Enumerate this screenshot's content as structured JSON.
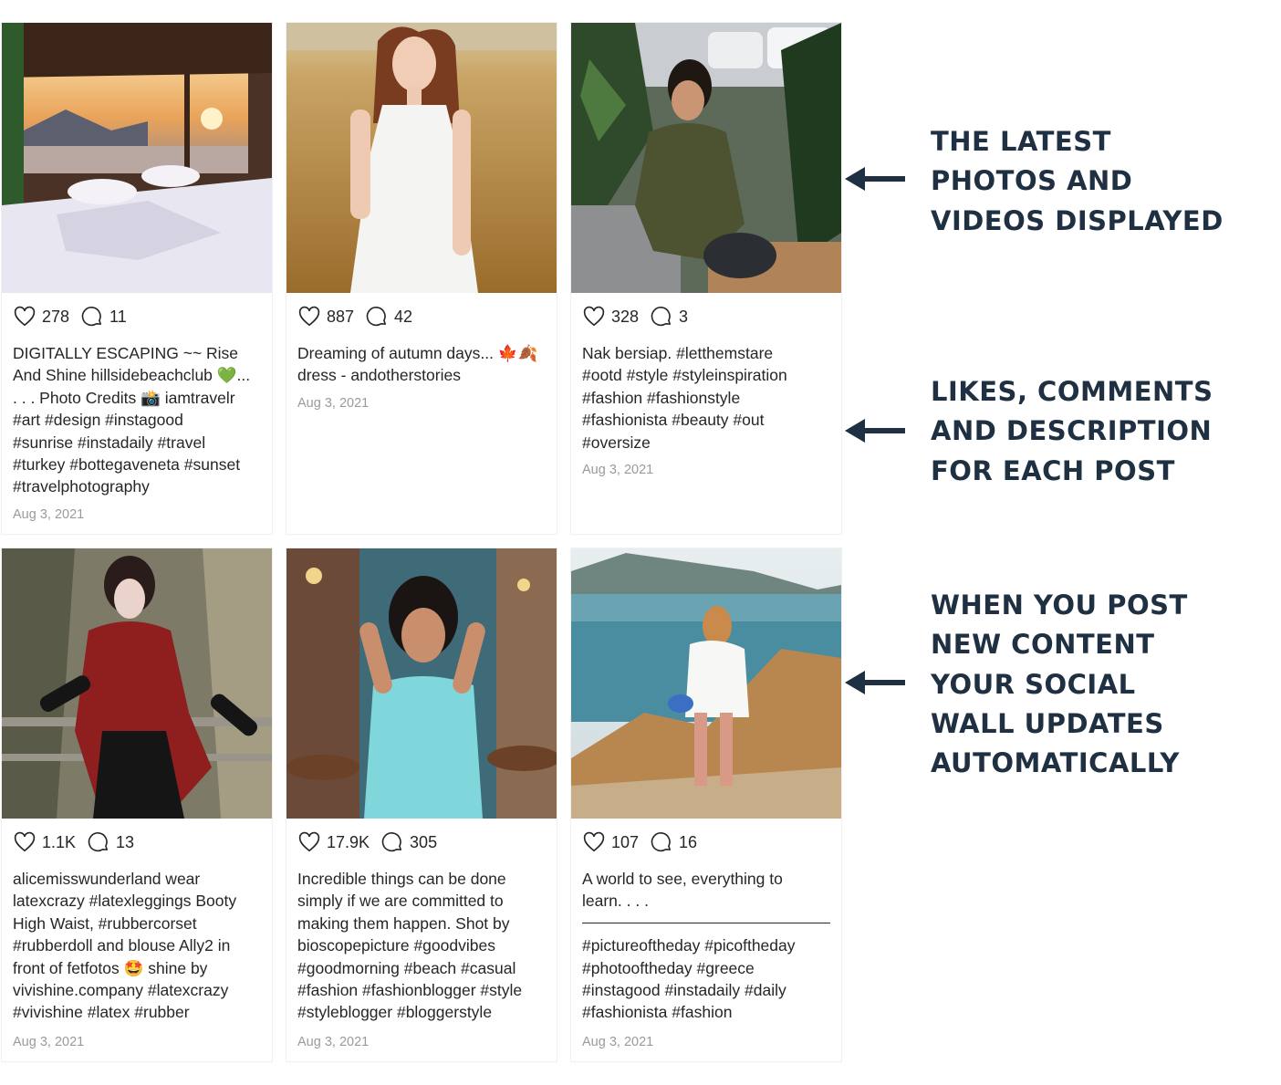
{
  "posts": [
    {
      "likes": "278",
      "comments": "11",
      "caption": "DIGITALLY ESCAPING ~~ Rise\nAnd Shine hillsidebeachclub 💚...\n. . . Photo Credits 📸 iamtravelr\n#art #design #instagood\n#sunrise #instadaily #travel\n#turkey #bottegaveneta #sunset\n#travelphotography",
      "date": "Aug 3, 2021",
      "image": "bedroom-sunset-sea-view-photo"
    },
    {
      "likes": "887",
      "comments": "42",
      "caption": "Dreaming of autumn days... 🍁🍂\ndress - andotherstories",
      "date": "Aug 3, 2021",
      "image": "woman-white-dress-wheat-field-photo"
    },
    {
      "likes": "328",
      "comments": "3",
      "caption": "Nak bersiap. #letthemstare\n#ootd #style #styleinspiration\n#fashion #fashionstyle\n#fashionista #beauty #out\n#oversize",
      "date": "Aug 3, 2021",
      "image": "woman-olive-dress-plants-photo"
    },
    {
      "likes": "1.1K",
      "comments": "13",
      "caption": "alicemisswunderland wear\nlatexcrazy #latexleggings Booty\nHigh Waist, #rubbercorset\n#rubberdoll and blouse Ally2 in\nfront of fetfotos 🤩 shine by\nvivishine.company #latexcrazy\n#vivishine #latex #rubber",
      "date": "Aug 3, 2021",
      "image": "woman-red-latex-blouse-forest-photo"
    },
    {
      "likes": "17.9K",
      "comments": "305",
      "caption": "Incredible things can be done\nsimply if we are committed to\nmaking them happen. Shot by\nbioscopepicture #goodvibes\n#goodmorning #beach #casual\n#fashion #fashionblogger #style\n#styleblogger #bloggerstyle",
      "date": "Aug 3, 2021",
      "image": "woman-turquoise-dress-cafe-photo"
    },
    {
      "likes": "107",
      "comments": "16",
      "caption": "A world to see, everything to\nlearn. . . .\n\n#pictureoftheday #picoftheday\n#photooftheday #greece\n#instagood #instadaily #daily\n#fashionista #fashion",
      "date": "Aug 3, 2021",
      "image": "woman-white-shirt-coastal-hill-photo"
    }
  ],
  "annotations": [
    {
      "text": "THE LATEST\nPHOTOS AND\nVIDEOS DISPLAYED",
      "icon": "arrow-left-icon"
    },
    {
      "text": "LIKES, COMMENTS\nAND DESCRIPTION\nFOR EACH POST",
      "icon": "arrow-left-icon"
    },
    {
      "text": "WHEN YOU POST\nNEW CONTENT\nYOUR SOCIAL\nWALL UPDATES\nAUTOMATICALLY",
      "icon": "arrow-left-icon"
    }
  ],
  "icons": {
    "likes": "heart-icon",
    "comments": "comment-bubble-icon"
  },
  "colors": {
    "annotation_text": "#1e3041",
    "caption_text": "#262626",
    "date_text": "#9a9a9a"
  }
}
